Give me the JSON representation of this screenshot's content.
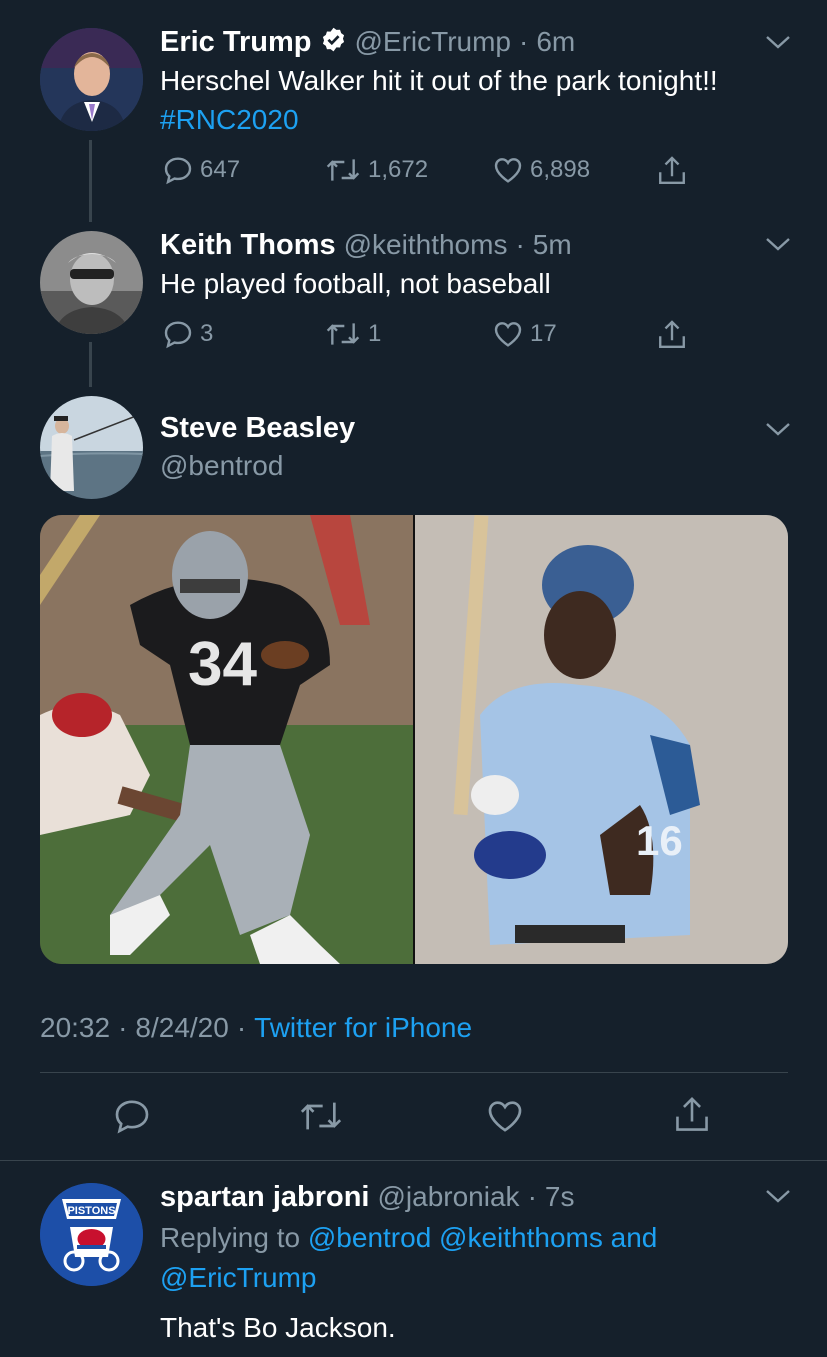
{
  "tweets": {
    "eric": {
      "name": "Eric Trump",
      "handle": "@EricTrump",
      "time": "6m",
      "text": "Herschel Walker hit it out of the park tonight!!",
      "hashtag": "#RNC2020",
      "replies": "647",
      "retweets": "1,672",
      "likes": "6,898"
    },
    "keith": {
      "name": "Keith Thoms",
      "handle": "@keiththoms",
      "time": "5m",
      "text": "He played football, not baseball",
      "replies": "3",
      "retweets": "1",
      "likes": "17"
    },
    "steve": {
      "name": "Steve Beasley",
      "handle": "@bentrod",
      "timestamp_time": "20:32",
      "timestamp_date": "8/24/20",
      "source": "Twitter for iPhone",
      "jersey_left": "34",
      "jersey_right": "16"
    },
    "spartan": {
      "name": "spartan jabroni",
      "handle": "@jabroniak",
      "time": "7s",
      "replying_prefix": "Replying to",
      "mention1": "@bentrod",
      "mention2": "@keiththoms",
      "and": "and",
      "mention3": "@EricTrump",
      "text": "That's Bo Jackson.",
      "avatar_text": "PISTONS"
    }
  },
  "separator": "·",
  "icons": [
    "verified-icon",
    "chevron-down-icon",
    "reply-icon",
    "retweet-icon",
    "like-icon",
    "share-icon"
  ],
  "colors": {
    "background": "#15202b",
    "accent": "#1da1f2",
    "muted": "#8899a6",
    "divider": "#38444d"
  }
}
